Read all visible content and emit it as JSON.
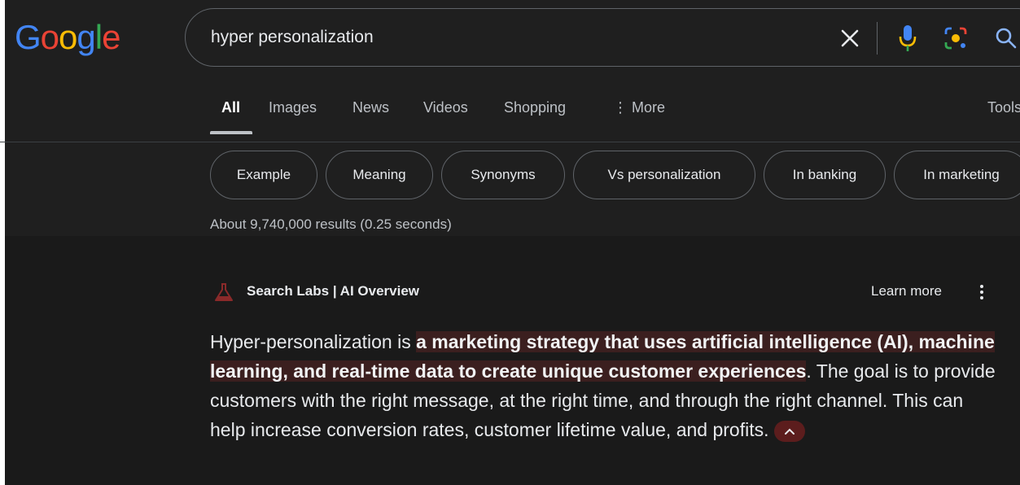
{
  "logo": {
    "letters": [
      "G",
      "o",
      "o",
      "g",
      "l",
      "e"
    ]
  },
  "search": {
    "query": "hyper personalization"
  },
  "tabs": [
    {
      "label": "All",
      "active": true
    },
    {
      "label": "Images"
    },
    {
      "label": "News"
    },
    {
      "label": "Videos"
    },
    {
      "label": "Shopping"
    },
    {
      "label": "⋮ More"
    },
    {
      "label": "Tools"
    }
  ],
  "chips": [
    "Example",
    "Meaning",
    "Synonyms",
    "Vs personalization",
    "In banking",
    "In marketing"
  ],
  "result_stats": "About 9,740,000 results (0.25 seconds)",
  "ai_overview": {
    "title": "Search Labs | AI Overview",
    "learn_more": "Learn more",
    "text_intro": "Hyper-personalization is ",
    "text_highlight": "a marketing strategy that uses artificial intelligence (AI), machine learning, and real-time data to create unique customer experiences",
    "text_rest": ". The goal is to provide customers with the right message, at the right time, and through the right channel. This can help increase conversion rates, customer lifetime value, and profits."
  },
  "colors": {
    "background": "#1f1f1f",
    "text": "#e8eaed",
    "highlight_bg": "#3b1f1f",
    "collapse_btn_bg": "#5c1d1d"
  },
  "icons": [
    "clear-icon",
    "mic-icon",
    "lens-icon",
    "search-icon",
    "labs-flask-icon",
    "kebab-menu-icon",
    "chevron-up-icon"
  ]
}
